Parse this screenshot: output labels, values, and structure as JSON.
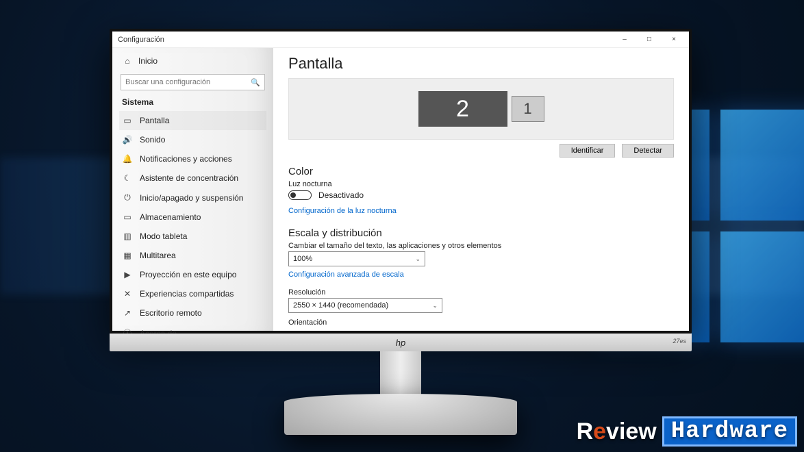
{
  "window": {
    "title": "Configuración",
    "minimize": "–",
    "maximize": "□",
    "close": "×"
  },
  "nav": {
    "home": "Inicio",
    "search_placeholder": "Buscar una configuración",
    "group": "Sistema",
    "items": [
      {
        "icon": "▭",
        "label": "Pantalla",
        "active": true
      },
      {
        "icon": "🔊",
        "label": "Sonido"
      },
      {
        "icon": "🔔",
        "label": "Notificaciones y acciones"
      },
      {
        "icon": "☾",
        "label": "Asistente de concentración"
      },
      {
        "icon": "⏻",
        "label": "Inicio/apagado y suspensión"
      },
      {
        "icon": "▭",
        "label": "Almacenamiento"
      },
      {
        "icon": "▥",
        "label": "Modo tableta"
      },
      {
        "icon": "▦",
        "label": "Multitarea"
      },
      {
        "icon": "▶",
        "label": "Proyección en este equipo"
      },
      {
        "icon": "✕",
        "label": "Experiencias compartidas"
      },
      {
        "icon": "↗",
        "label": "Escritorio remoto"
      },
      {
        "icon": "ⓘ",
        "label": "Acerca de"
      }
    ]
  },
  "main": {
    "heading": "Pantalla",
    "displays": {
      "primary": "2",
      "secondary": "1"
    },
    "buttons": {
      "identify": "Identificar",
      "detect": "Detectar"
    },
    "color": {
      "title": "Color",
      "night_light_label": "Luz nocturna",
      "toggle_state": "Desactivado",
      "night_light_settings": "Configuración de la luz nocturna"
    },
    "scale": {
      "title": "Escala y distribución",
      "size_label": "Cambiar el tamaño del texto, las aplicaciones y otros elementos",
      "size_value": "100%",
      "advanced_scaling": "Configuración avanzada de escala",
      "resolution_label": "Resolución",
      "resolution_value": "2550 × 1440 (recomendada)",
      "orientation_label": "Orientación"
    }
  },
  "monitor_brand": "hp",
  "monitor_model": "27es",
  "watermark": {
    "review": "Review",
    "hardware": "Hardware"
  }
}
